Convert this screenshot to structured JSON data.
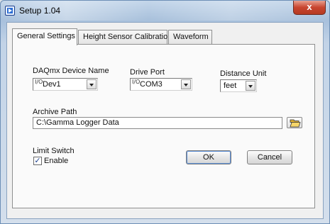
{
  "window": {
    "title": "Setup  1.04",
    "close_glyph": "x"
  },
  "tabs": [
    {
      "label": "General Settings",
      "active": true
    },
    {
      "label": "Height Sensor Calibration",
      "active": false
    },
    {
      "label": "Waveform",
      "active": false
    }
  ],
  "daqmx": {
    "label": "DAQmx Device Name",
    "io_glyph": "I/O",
    "value": "Dev1"
  },
  "drive_port": {
    "label": "Drive Port",
    "io_glyph": "I/O",
    "value": "COM3"
  },
  "distance_unit": {
    "label": "Distance Unit",
    "value": "feet"
  },
  "archive": {
    "label": "Archive Path",
    "value": "C:\\Gamma Logger Data",
    "browse_icon": "folder-open-icon"
  },
  "limit_switch": {
    "label": "Limit Switch",
    "checkbox_label": "Enable",
    "checked": true,
    "check_glyph": "✓"
  },
  "buttons": {
    "ok": "OK",
    "cancel": "Cancel"
  },
  "colors": {
    "accent": "#5b8ed6",
    "close_button": "#c8452f"
  }
}
